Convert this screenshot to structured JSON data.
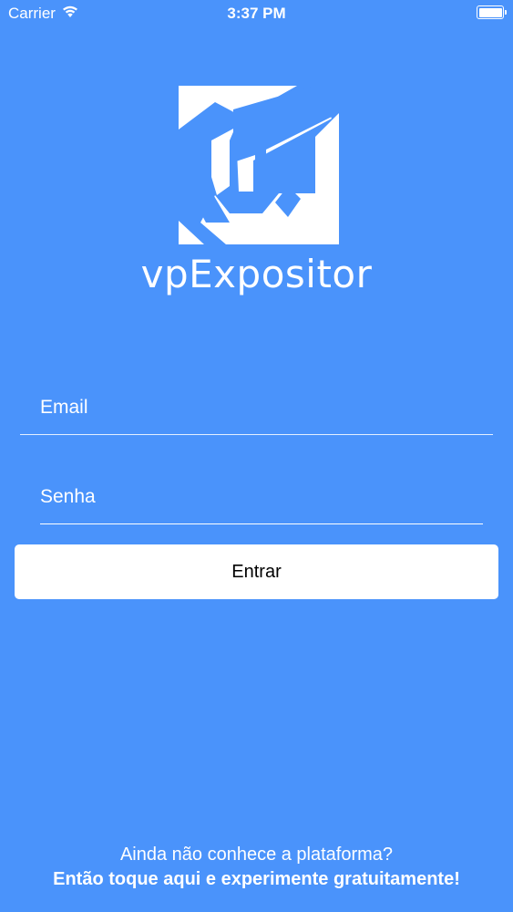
{
  "status_bar": {
    "carrier": "Carrier",
    "time": "3:37 PM",
    "wifi_icon": "wifi-icon",
    "battery_icon": "battery-icon"
  },
  "brand": {
    "logo_icon": "vpexpositor-logo-icon",
    "name": "vpExpositor"
  },
  "login": {
    "email_placeholder": "Email",
    "password_placeholder": "Senha",
    "submit_label": "Entrar"
  },
  "footer": {
    "question": "Ainda não conhece a plataforma?",
    "cta": "Então toque aqui e experimente gratuitamente!"
  },
  "colors": {
    "background": "#4a93fb",
    "text": "#ffffff",
    "button_bg": "#ffffff",
    "button_text": "#000000"
  }
}
